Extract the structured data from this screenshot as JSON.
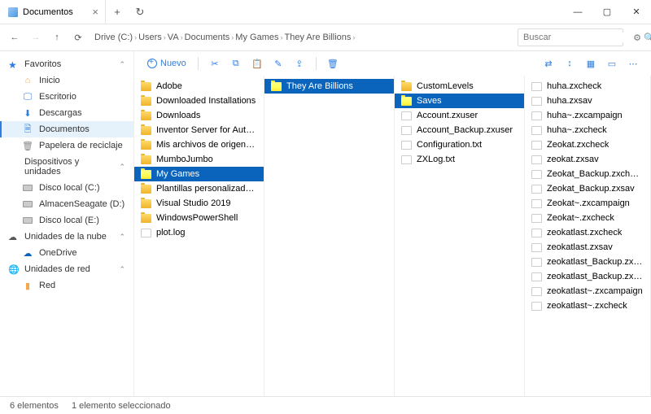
{
  "tab_title": "Documentos",
  "breadcrumb": [
    "Drive (C:)",
    "Users",
    "VA",
    "Documents",
    "My Games",
    "They Are Billions"
  ],
  "search_placeholder": "Buscar",
  "toolbar_new": "Nuevo",
  "sidebar": {
    "favorites_label": "Favoritos",
    "favorites": [
      {
        "icon": "home",
        "label": "Inicio"
      },
      {
        "icon": "desktop",
        "label": "Escritorio"
      },
      {
        "icon": "download",
        "label": "Descargas"
      },
      {
        "icon": "doc",
        "label": "Documentos",
        "selected": true
      },
      {
        "icon": "trash",
        "label": "Papelera de reciclaje"
      }
    ],
    "devices_label": "Dispositivos y unidades",
    "devices": [
      {
        "label": "Disco local (C:)"
      },
      {
        "label": "AlmacenSeagate (D:)"
      },
      {
        "label": "Disco local (E:)"
      }
    ],
    "cloud_label": "Unidades de la nube",
    "cloud": [
      {
        "label": "OneDrive"
      }
    ],
    "network_label": "Unidades de red",
    "network": [
      {
        "label": "Red"
      }
    ]
  },
  "columns": [
    [
      {
        "t": "folder",
        "label": "Adobe"
      },
      {
        "t": "folder",
        "label": "Downloaded Installations"
      },
      {
        "t": "folder",
        "label": "Downloads"
      },
      {
        "t": "folder",
        "label": "Inventor Server for AutoCAD"
      },
      {
        "t": "folder",
        "label": "Mis archivos de origen de datos",
        "special": true
      },
      {
        "t": "folder",
        "label": "MumboJumbo"
      },
      {
        "t": "folder",
        "label": "My Games",
        "selected": true
      },
      {
        "t": "folder",
        "label": "Plantillas personalizadas de Office"
      },
      {
        "t": "folder",
        "label": "Visual Studio 2019"
      },
      {
        "t": "folder",
        "label": "WindowsPowerShell"
      },
      {
        "t": "file",
        "label": "plot.log"
      }
    ],
    [
      {
        "t": "folder",
        "label": "They Are Billions",
        "selected": true
      }
    ],
    [
      {
        "t": "folder",
        "label": "CustomLevels"
      },
      {
        "t": "folder",
        "label": "Saves",
        "selected": true
      },
      {
        "t": "file",
        "label": "Account.zxuser"
      },
      {
        "t": "file",
        "label": "Account_Backup.zxuser"
      },
      {
        "t": "file",
        "label": "Configuration.txt"
      },
      {
        "t": "file",
        "label": "ZXLog.txt"
      }
    ],
    [
      {
        "t": "file",
        "label": "huha.zxcheck"
      },
      {
        "t": "file",
        "label": "huha.zxsav"
      },
      {
        "t": "file",
        "label": "huha~.zxcampaign"
      },
      {
        "t": "file",
        "label": "huha~.zxcheck"
      },
      {
        "t": "file",
        "label": "Zeokat.zxcheck"
      },
      {
        "t": "file",
        "label": "zeokat.zxsav"
      },
      {
        "t": "file",
        "label": "Zeokat_Backup.zxcheck"
      },
      {
        "t": "file",
        "label": "Zeokat_Backup.zxsav"
      },
      {
        "t": "file",
        "label": "Zeokat~.zxcampaign"
      },
      {
        "t": "file",
        "label": "Zeokat~.zxcheck"
      },
      {
        "t": "file",
        "label": "zeokatlast.zxcheck"
      },
      {
        "t": "file",
        "label": "zeokatlast.zxsav"
      },
      {
        "t": "file",
        "label": "zeokatlast_Backup.zxcheck"
      },
      {
        "t": "file",
        "label": "zeokatlast_Backup.zxsav"
      },
      {
        "t": "file",
        "label": "zeokatlast~.zxcampaign"
      },
      {
        "t": "file",
        "label": "zeokatlast~.zxcheck"
      }
    ]
  ],
  "status_count": "6 elementos",
  "status_selected": "1 elemento seleccionado"
}
